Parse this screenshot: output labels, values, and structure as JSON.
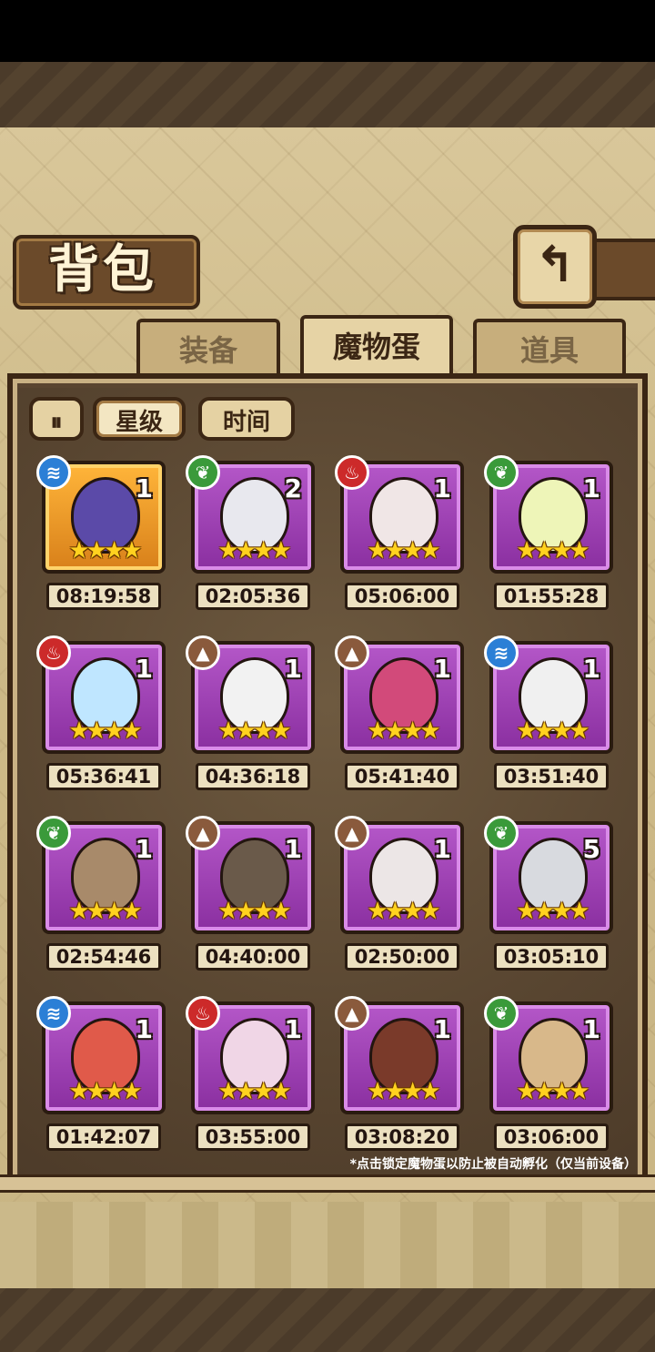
{
  "title": "背包",
  "back_icon": "↰",
  "tabs": [
    {
      "label": "装备"
    },
    {
      "label": "魔物蛋"
    },
    {
      "label": "道具"
    }
  ],
  "sort": {
    "order_icon": "⏸",
    "star_label": "星级",
    "time_label": "时间"
  },
  "eggs": [
    {
      "element": "water",
      "count": "1",
      "stars": 4,
      "timer": "08:19:58",
      "egg_color": "#5b4aa8",
      "highlight": "gold"
    },
    {
      "element": "grass",
      "count": "2",
      "stars": 4,
      "timer": "02:05:36",
      "egg_color": "#e8e8ee"
    },
    {
      "element": "fire",
      "count": "1",
      "stars": 4,
      "timer": "05:06:00",
      "egg_color": "#f0e6e6"
    },
    {
      "element": "grass",
      "count": "1",
      "stars": 4,
      "timer": "01:55:28",
      "egg_color": "#eef5b8"
    },
    {
      "element": "fire",
      "count": "1",
      "stars": 4,
      "timer": "05:36:41",
      "egg_color": "#bfe6ff"
    },
    {
      "element": "earth",
      "count": "1",
      "stars": 4,
      "timer": "04:36:18",
      "egg_color": "#f2f2f2"
    },
    {
      "element": "earth",
      "count": "1",
      "stars": 4,
      "timer": "05:41:40",
      "egg_color": "#d24a7a"
    },
    {
      "element": "water",
      "count": "1",
      "stars": 4,
      "timer": "03:51:40",
      "egg_color": "#f0f0f0"
    },
    {
      "element": "grass",
      "count": "1",
      "stars": 4,
      "timer": "02:54:46",
      "egg_color": "#a88a6a"
    },
    {
      "element": "earth",
      "count": "1",
      "stars": 4,
      "timer": "04:40:00",
      "egg_color": "#6a5a4a"
    },
    {
      "element": "earth",
      "count": "1",
      "stars": 4,
      "timer": "02:50:00",
      "egg_color": "#ece6e6"
    },
    {
      "element": "grass",
      "count": "5",
      "stars": 4,
      "timer": "03:05:10",
      "egg_color": "#d8dadf"
    },
    {
      "element": "water",
      "count": "1",
      "stars": 4,
      "timer": "01:42:07",
      "egg_color": "#e05a4a"
    },
    {
      "element": "fire",
      "count": "1",
      "stars": 4,
      "timer": "03:55:00",
      "egg_color": "#f0d6e6"
    },
    {
      "element": "earth",
      "count": "1",
      "stars": 4,
      "timer": "03:08:20",
      "egg_color": "#7a3a2a"
    },
    {
      "element": "grass",
      "count": "1",
      "stars": 4,
      "timer": "03:06:00",
      "egg_color": "#d8b88a"
    }
  ],
  "element_icons": {
    "water": "≋",
    "grass": "❦",
    "fire": "♨",
    "earth": "▲"
  },
  "footnote": "*点击锁定魔物蛋以防止被自动孵化（仅当前设备）"
}
